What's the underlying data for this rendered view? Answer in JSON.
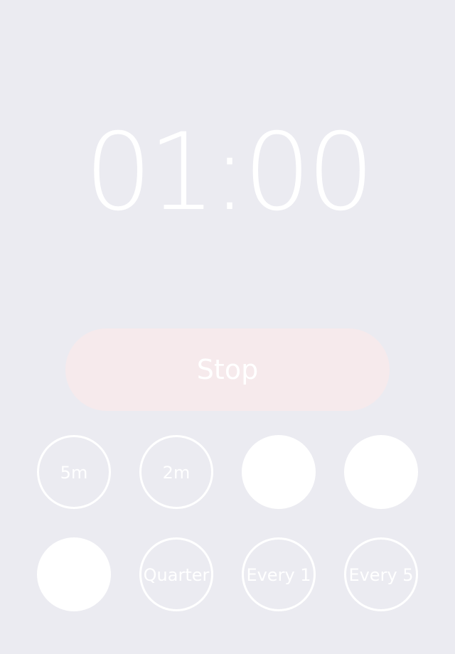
{
  "timer": {
    "display": "01:00"
  },
  "stop_button": {
    "label": "Stop"
  },
  "presets": {
    "row1": [
      {
        "label": "5m",
        "style": "outline"
      },
      {
        "label": "2m",
        "style": "outline"
      },
      {
        "label": "",
        "style": "filled"
      },
      {
        "label": "",
        "style": "filled"
      }
    ],
    "row2": [
      {
        "label": "",
        "style": "filled"
      },
      {
        "label": "Quarter",
        "style": "outline"
      },
      {
        "label": "Every 1",
        "style": "outline"
      },
      {
        "label": "Every 5",
        "style": "outline"
      }
    ]
  },
  "colors": {
    "background": "#ebebf1",
    "stop_button_bg": "#f6eaec",
    "foreground": "#ffffff"
  }
}
